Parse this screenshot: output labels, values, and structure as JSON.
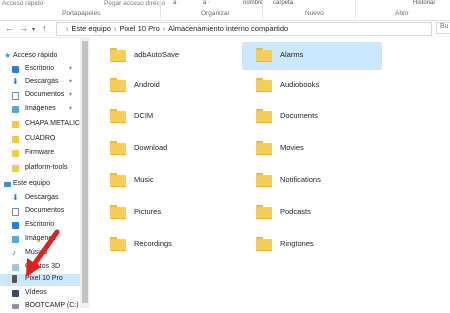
{
  "ribbon": {
    "top_items": [
      "Acceso rápido",
      "Pegar acceso directo",
      "a ·",
      "a ·",
      "nombre",
      "carpeta",
      "Historial"
    ],
    "groups": [
      "Portapapeles",
      "Organizar",
      "Nuevo",
      "Abrir"
    ]
  },
  "addressbar": {
    "back_glyph": "←",
    "forward_glyph": "→",
    "up_glyph": "↑",
    "crumbs": [
      "Este equipo",
      "Pixel 10 Pro",
      "Almacenamiento interno compartido"
    ],
    "search_text": "Bu"
  },
  "sidebar": {
    "items": [
      {
        "label": "Acceso rápido",
        "icon": "star-icon",
        "pinned": false
      },
      {
        "label": "Escritorio",
        "icon": "desktop-icon",
        "pinned": true
      },
      {
        "label": "Descargas",
        "icon": "download-icon",
        "pinned": true
      },
      {
        "label": "Documentos",
        "icon": "documents-icon",
        "pinned": true
      },
      {
        "label": "Imágenes",
        "icon": "images-icon",
        "pinned": true
      },
      {
        "label": "CHAPA METALICA",
        "icon": "folder-icon",
        "pinned": false
      },
      {
        "label": "CUADRO",
        "icon": "folder-icon",
        "pinned": false
      },
      {
        "label": "Firmware",
        "icon": "folder-icon",
        "pinned": false
      },
      {
        "label": "platform-tools",
        "icon": "folder-icon",
        "pinned": false
      },
      {
        "label": "Este equipo",
        "icon": "pc-icon",
        "pinned": false
      },
      {
        "label": "Descargas",
        "icon": "download-icon",
        "pinned": false
      },
      {
        "label": "Documentos",
        "icon": "documents-icon",
        "pinned": false
      },
      {
        "label": "Escritorio",
        "icon": "desktop-icon",
        "pinned": false
      },
      {
        "label": "Imágenes",
        "icon": "images-icon",
        "pinned": false
      },
      {
        "label": "Música",
        "icon": "music-icon",
        "pinned": false
      },
      {
        "label": "Objetos 3D",
        "icon": "objects-3d-icon",
        "pinned": false
      },
      {
        "label": "Pixel 10 Pro",
        "icon": "phone-icon",
        "pinned": false
      },
      {
        "label": "Vídeos",
        "icon": "videos-icon",
        "pinned": false
      },
      {
        "label": "BOOTCAMP (C:)",
        "icon": "drive-icon",
        "pinned": false
      }
    ],
    "pin_glyph": "📌"
  },
  "folders": [
    {
      "name": "adbAutoSave"
    },
    {
      "name": "Alarms"
    },
    {
      "name": "Android"
    },
    {
      "name": "Audiobooks"
    },
    {
      "name": "DCIM"
    },
    {
      "name": "Documents"
    },
    {
      "name": "Download"
    },
    {
      "name": "Movies"
    },
    {
      "name": "Music"
    },
    {
      "name": "Notifications"
    },
    {
      "name": "Pictures"
    },
    {
      "name": "Podcasts"
    },
    {
      "name": "Recordings"
    },
    {
      "name": "Ringtones"
    }
  ],
  "colors": {
    "selection": "#cce8ff",
    "folder": "#f7cd5a",
    "arrow": "#e02020"
  }
}
